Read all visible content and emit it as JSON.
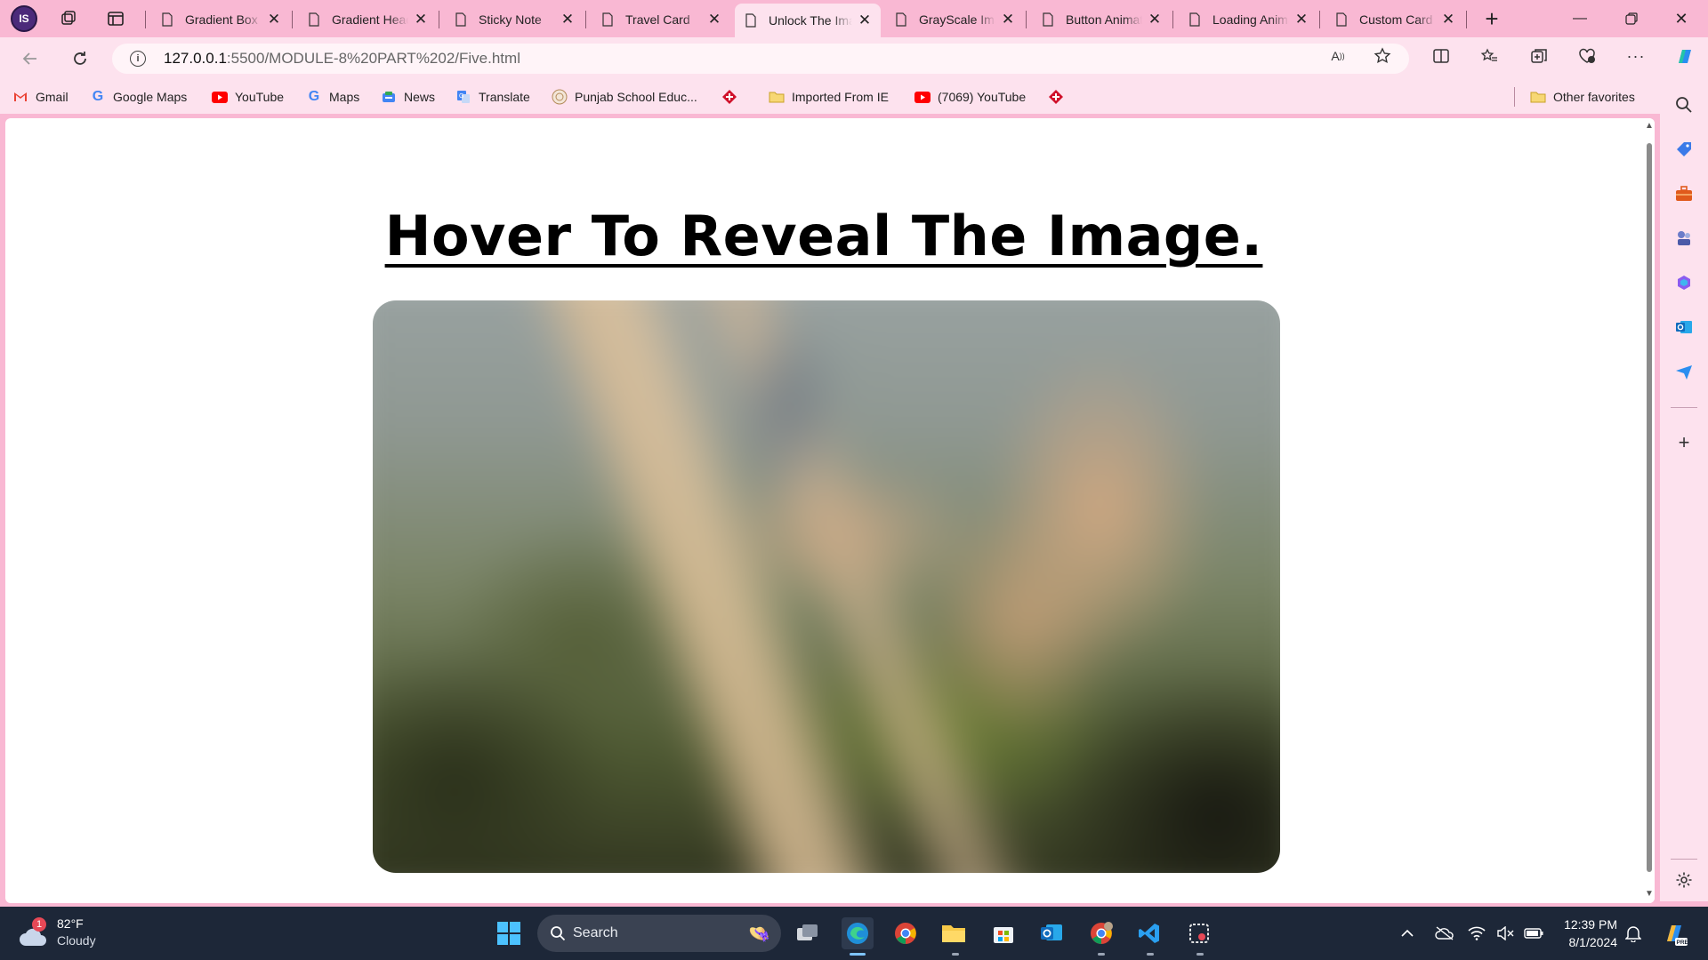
{
  "browser": {
    "profile_initials": "IS",
    "tabs": [
      {
        "label": "Gradient Box",
        "active": false
      },
      {
        "label": "Gradient Heading",
        "active": false
      },
      {
        "label": "Sticky Note",
        "active": false
      },
      {
        "label": "Travel Card",
        "active": false
      },
      {
        "label": "Unlock The Image",
        "active": true
      },
      {
        "label": "GrayScale Image",
        "active": false
      },
      {
        "label": "Button Animation",
        "active": false
      },
      {
        "label": "Loading Animation",
        "active": false
      },
      {
        "label": "Custom Card",
        "active": false
      }
    ],
    "address": {
      "host": "127.0.0.1",
      "path": ":5500/MODULE-8%20PART%202/Five.html"
    },
    "favorites": [
      {
        "label": "Gmail",
        "icon": "gmail-icon"
      },
      {
        "label": "Google Maps",
        "icon": "google-icon"
      },
      {
        "label": "YouTube",
        "icon": "youtube-icon"
      },
      {
        "label": "Maps",
        "icon": "google-icon"
      },
      {
        "label": "News",
        "icon": "news-icon"
      },
      {
        "label": "Translate",
        "icon": "translate-icon"
      },
      {
        "label": "Punjab School Educ...",
        "icon": "school-icon"
      },
      {
        "label": "",
        "icon": "red-diamond-icon"
      },
      {
        "label": "Imported From IE",
        "icon": "folder-icon"
      },
      {
        "label": "(7069) YouTube",
        "icon": "youtube-icon"
      },
      {
        "label": "",
        "icon": "red-diamond-icon"
      }
    ],
    "other_favorites": "Other favorites"
  },
  "page": {
    "heading": "Hover To Reveal The Image."
  },
  "taskbar": {
    "weather": {
      "temp": "82°F",
      "condition": "Cloudy",
      "badge": "1"
    },
    "search_label": "Search",
    "time": "12:39 PM",
    "date": "8/1/2024"
  },
  "colors": {
    "browser_frame": "#f9b8d3",
    "toolbar": "#fde2ee",
    "taskbar": "#1d2738"
  }
}
